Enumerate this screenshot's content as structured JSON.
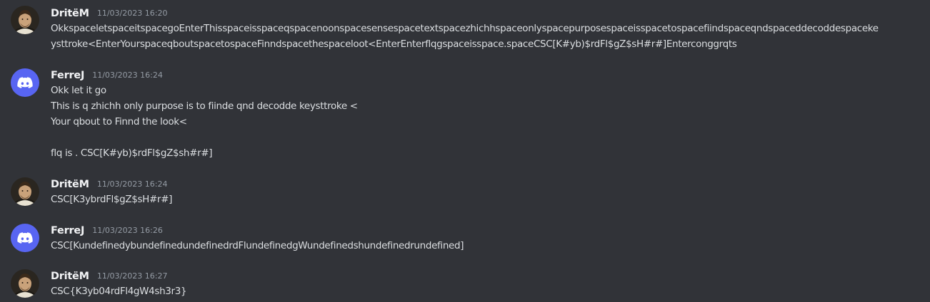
{
  "messages": [
    {
      "author": "DritëM",
      "timestamp": "11/03/2023 16:20",
      "avatar": "shakespeare-portrait",
      "lines": [
        "OkkspaceletspaceitspacegoEnterThisspaceisspaceqspacenoonspacesensespacetextspacezhichhspaceonlyspacepurposespaceisspacetospacefiindspaceqndspaceddecoddespaceke",
        "ysttroke<EnterYourspaceqboutspacetospaceFinndspacethespaceloot<EnterEnterflqgspaceisspace.spaceCSC[K#yb)$rdFl$gZ$sH#r#]Enterconggrqts"
      ]
    },
    {
      "author": "FerreJ",
      "timestamp": "11/03/2023 16:24",
      "avatar": "discord-logo",
      "lines": [
        "Okk let it go",
        "This is q zhichh only purpose is to fiinde qnd decodde keysttroke <",
        "Your qbout to Finnd the look<",
        "",
        "flq is . CSC[K#yb)$rdFl$gZ$sh#r#]"
      ]
    },
    {
      "author": "DritëM",
      "timestamp": "11/03/2023 16:24",
      "avatar": "shakespeare-portrait",
      "lines": [
        "CSC[K3ybrdFl$gZ$sH#r#]"
      ]
    },
    {
      "author": "FerreJ",
      "timestamp": "11/03/2023 16:26",
      "avatar": "discord-logo",
      "lines": [
        "CSC[KundefinedybundefinedundefinedrdFlundefinedgWundefinedshundefinedrundefined]"
      ]
    },
    {
      "author": "DritëM",
      "timestamp": "11/03/2023 16:27",
      "avatar": "shakespeare-portrait",
      "lines": [
        "CSC{K3yb04rdFl4gW4sh3r3}"
      ]
    }
  ],
  "colors": {
    "background": "#313338",
    "author": "#f2f3f5",
    "timestamp": "#949ba4",
    "text": "#dbdee1",
    "discord_blurple": "#5865f2"
  }
}
